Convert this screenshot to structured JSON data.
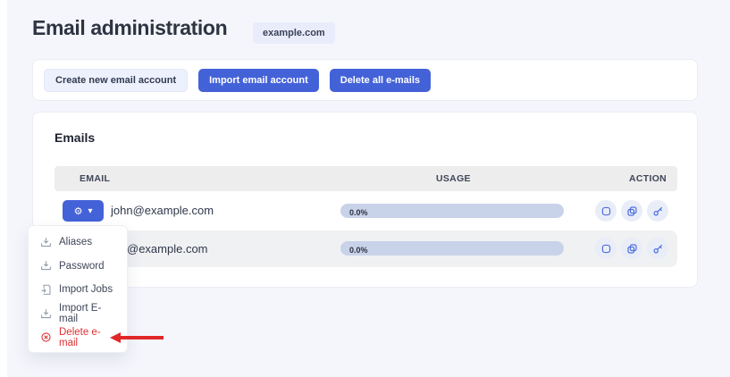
{
  "page": {
    "background": "#f5f6fc",
    "accent_blue": "#4462d8",
    "danger_red": "#e02f33"
  },
  "header": {
    "title": "Email administration",
    "domain_badge": "example.com"
  },
  "toolbar": {
    "buttons": [
      {
        "label": "Create new email account",
        "variant": "light"
      },
      {
        "label": "Import email account",
        "variant": "primary"
      },
      {
        "label": "Delete all e-mails",
        "variant": "primary"
      }
    ]
  },
  "emails_card": {
    "title": "Emails",
    "table": {
      "columns": [
        "EMAIL",
        "USAGE",
        "ACTION"
      ],
      "rows": [
        {
          "email": "john@example.com",
          "usage": "0.0%",
          "actions": [
            "square-icon",
            "copy-icon",
            "key-icon"
          ],
          "has_settings_dropdown": true
        },
        {
          "email": "@example.com",
          "usage": "0.0%",
          "actions": [
            "square-icon",
            "copy-icon",
            "key-icon"
          ],
          "note": "left part of email covered by open dropdown"
        }
      ]
    }
  },
  "icons": {
    "gear": "⚙",
    "caret_down": "▼"
  },
  "dropdown_menu": {
    "items": [
      {
        "label": "Aliases",
        "icon": "download-tray-icon"
      },
      {
        "label": "Password",
        "icon": "download-tray-icon"
      },
      {
        "label": "Import Jobs",
        "icon": "import-document-icon"
      },
      {
        "label": "Import E-mail",
        "icon": "download-tray-icon"
      },
      {
        "label": "Delete e-mail",
        "icon": "circle-x-icon",
        "danger": true
      }
    ]
  },
  "annotation": {
    "type": "arrow",
    "color": "#e02828",
    "points_to": "Delete e-mail"
  }
}
